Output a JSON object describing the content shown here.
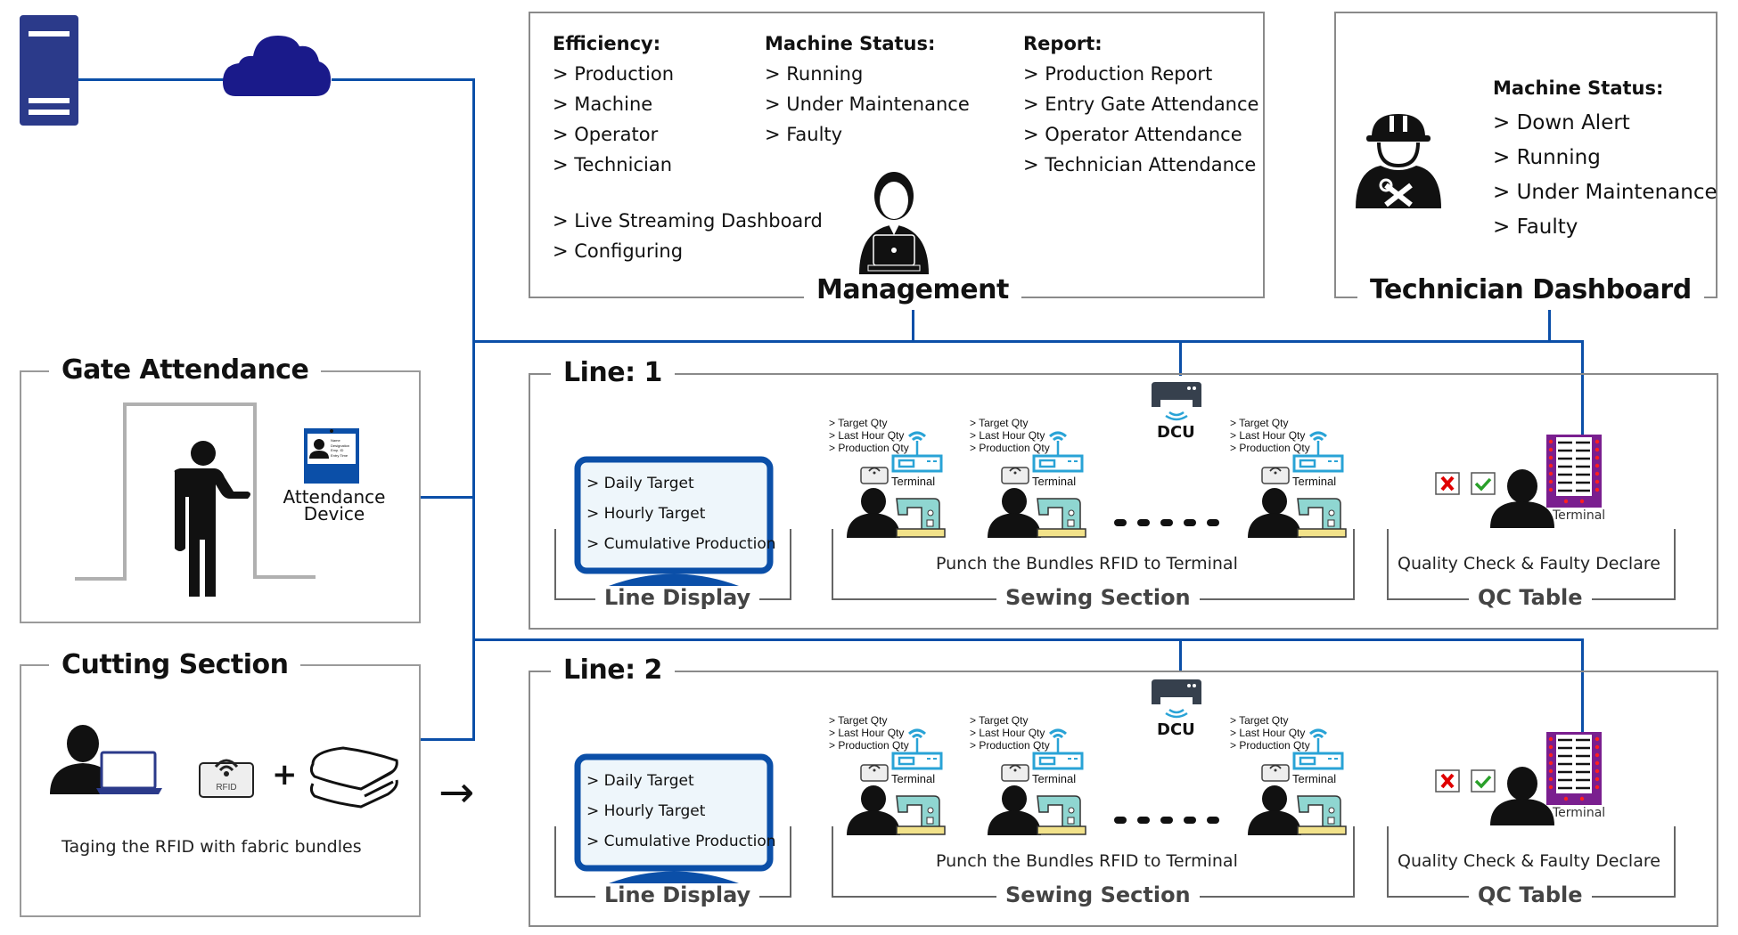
{
  "infrastructure": {
    "server_icon": "server-icon",
    "cloud_icon": "cloud-icon"
  },
  "management": {
    "title": "Management",
    "columns": [
      {
        "heading": "Efficiency:",
        "items": [
          "> Production",
          "> Machine",
          "> Operator",
          "> Technician"
        ]
      },
      {
        "heading": "Machine Status:",
        "items": [
          "> Running",
          "> Under Maintenance",
          "> Faulty"
        ]
      },
      {
        "heading": "Report:",
        "items": [
          "> Production Report",
          "> Entry Gate Attendance",
          "> Operator Attendance",
          "> Technician Attendance"
        ]
      }
    ],
    "extra_items": [
      "> Live Streaming Dashboard",
      "> Configuring"
    ],
    "icon": "manager-laptop-icon"
  },
  "technician": {
    "title": "Technician Dashboard",
    "heading": "Machine Status:",
    "items": [
      "> Down Alert",
      "> Running",
      "> Under Maintenance",
      "> Faulty"
    ],
    "icon": "technician-icon"
  },
  "gate": {
    "title": "Gate Attendance",
    "device_label_1": "Attendance",
    "device_label_2": "Device",
    "card_fields": [
      "Name",
      "Designation",
      "Emp. ID",
      "Entry Time"
    ]
  },
  "cutting": {
    "title": "Cutting Section",
    "rfid_label": "RFID",
    "plus": "+",
    "caption": "Taging the RFID with fabric bundles",
    "arrow": "→"
  },
  "lines": [
    {
      "title": "Line: 1",
      "display": {
        "items": [
          "> Daily Target",
          "> Hourly Target",
          "> Cumulative Production"
        ],
        "label": "Line Display"
      },
      "sewing": {
        "terminal_info": [
          "> Target Qty",
          "> Last Hour Qty",
          "> Production Qty"
        ],
        "terminal_label": "Terminal",
        "rfid_label": "RFID",
        "caption": "Punch the Bundles RFID to Terminal",
        "label": "Sewing  Section"
      },
      "dcu_label": "DCU",
      "qc": {
        "terminal_label": "Terminal",
        "caption": "Quality Check & Faulty Declare",
        "label": "QC  Table"
      }
    },
    {
      "title": "Line: 2",
      "display": {
        "items": [
          "> Daily Target",
          "> Hourly Target",
          "> Cumulative Production"
        ],
        "label": "Line Display"
      },
      "sewing": {
        "terminal_info": [
          "> Target Qty",
          "> Last Hour Qty",
          "> Production Qty"
        ],
        "terminal_label": "Terminal",
        "rfid_label": "RFID",
        "caption": "Punch the Bundles RFID to Terminal",
        "label": "Sewing  Section"
      },
      "dcu_label": "DCU",
      "qc": {
        "terminal_label": "Terminal",
        "caption": "Quality Check & Faulty Declare",
        "label": "QC  Table"
      }
    }
  ],
  "colors": {
    "network_line": "#0b4fa8",
    "server": "#2b3a8a",
    "cloud": "#1a1a8a",
    "display": "#0b4fa8",
    "terminal": "#29a3d6",
    "qc_terminal": "#7a1f8f",
    "reject": "#e00000",
    "accept": "#2aa02a"
  }
}
